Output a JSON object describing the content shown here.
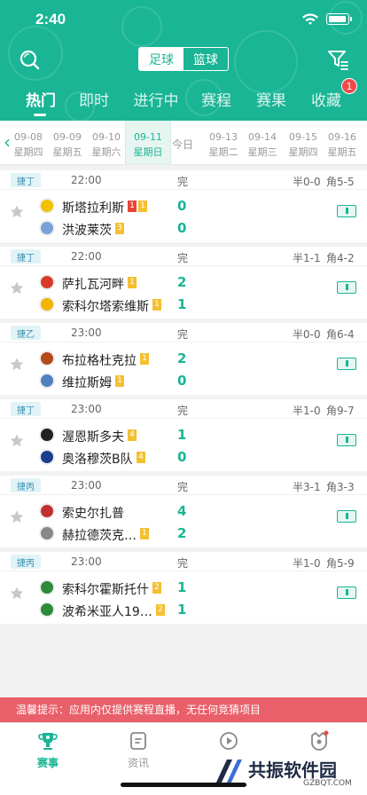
{
  "status_bar": {
    "time": "2:40"
  },
  "header": {
    "sport_tabs": [
      "足球",
      "篮球"
    ],
    "active_sport": "足球",
    "tabs": [
      "热门",
      "即时",
      "进行中",
      "赛程",
      "赛果",
      "收藏"
    ],
    "active_tab": "热门",
    "favorites_badge": "1"
  },
  "date_strip": {
    "dates": [
      {
        "date": "09-08",
        "weekday": "星期四"
      },
      {
        "date": "09-09",
        "weekday": "星期五"
      },
      {
        "date": "09-10",
        "weekday": "星期六"
      },
      {
        "date": "09-11",
        "weekday": "星期日"
      },
      {
        "date": "今日",
        "weekday": ""
      },
      {
        "date": "09-13",
        "weekday": "星期二"
      },
      {
        "date": "09-14",
        "weekday": "星期三"
      },
      {
        "date": "09-15",
        "weekday": "星期四"
      },
      {
        "date": "09-16",
        "weekday": "星期五"
      }
    ],
    "selected": "09-11"
  },
  "matches": [
    {
      "league": "捷丁",
      "time": "22:00",
      "status": "完",
      "half": "半0-0",
      "corner": "角5-5",
      "home": {
        "name": "斯塔拉利斯",
        "cards": [
          {
            "type": "red",
            "n": "1"
          },
          {
            "type": "yellow",
            "n": "1"
          }
        ],
        "score": "0"
      },
      "away": {
        "name": "洪波莱茨",
        "cards": [
          {
            "type": "yellow",
            "n": "3"
          }
        ],
        "score": "0"
      }
    },
    {
      "league": "捷丁",
      "time": "22:00",
      "status": "完",
      "half": "半1-1",
      "corner": "角4-2",
      "home": {
        "name": "萨扎瓦河畔",
        "cards": [
          {
            "type": "yellow",
            "n": "1"
          }
        ],
        "score": "2"
      },
      "away": {
        "name": "索科尔塔索维斯",
        "cards": [
          {
            "type": "yellow",
            "n": "1"
          }
        ],
        "score": "1"
      }
    },
    {
      "league": "捷乙",
      "time": "23:00",
      "status": "完",
      "half": "半0-0",
      "corner": "角6-4",
      "home": {
        "name": "布拉格杜克拉",
        "cards": [
          {
            "type": "yellow",
            "n": "1"
          }
        ],
        "score": "2"
      },
      "away": {
        "name": "维拉斯姆",
        "cards": [
          {
            "type": "yellow",
            "n": "1"
          }
        ],
        "score": "0"
      }
    },
    {
      "league": "捷丁",
      "time": "23:00",
      "status": "完",
      "half": "半1-0",
      "corner": "角9-7",
      "home": {
        "name": "渥恩斯多夫",
        "cards": [
          {
            "type": "yellow",
            "n": "4"
          }
        ],
        "score": "1"
      },
      "away": {
        "name": "奥洛穆茨B队",
        "cards": [
          {
            "type": "yellow",
            "n": "4"
          }
        ],
        "score": "0"
      }
    },
    {
      "league": "捷丙",
      "time": "23:00",
      "status": "完",
      "half": "半3-1",
      "corner": "角3-3",
      "home": {
        "name": "索史尔扎普",
        "cards": [],
        "score": "4"
      },
      "away": {
        "name": "赫拉德茨克…",
        "cards": [
          {
            "type": "yellow",
            "n": "1"
          }
        ],
        "score": "2"
      }
    },
    {
      "league": "捷丙",
      "time": "23:00",
      "status": "完",
      "half": "半1-0",
      "corner": "角5-9",
      "home": {
        "name": "索科尔霍斯托什",
        "cards": [
          {
            "type": "yellow",
            "n": "2"
          }
        ],
        "score": "1"
      },
      "away": {
        "name": "波希米亚人19…",
        "cards": [
          {
            "type": "yellow",
            "n": "2"
          }
        ],
        "score": "1"
      }
    }
  ],
  "notice": "温馨提示：应用内仅提供赛程直播，无任何竞猜项目",
  "bottom_nav": [
    {
      "label": "赛事",
      "icon": "trophy-icon"
    },
    {
      "label": "资讯",
      "icon": "news-icon"
    },
    {
      "label": "",
      "icon": "play-icon"
    },
    {
      "label": "",
      "icon": "profile-icon"
    }
  ],
  "watermark": {
    "title": "共振软件园",
    "sub": "GZBQT.COM"
  },
  "colors": {
    "primary": "#19b595",
    "notice": "#e9606a",
    "red_card": "#e8443a",
    "yellow_card": "#f4c032"
  }
}
